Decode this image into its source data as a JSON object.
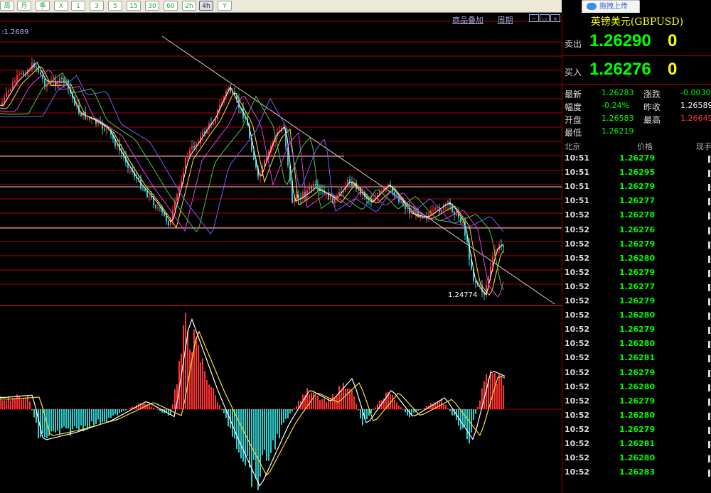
{
  "toolbar": {
    "buttons": [
      "周",
      "月",
      "季",
      "X",
      "1",
      "3",
      "5",
      "15",
      "30",
      "60",
      "2h",
      "4h",
      "Y"
    ],
    "active_index": 11
  },
  "chart_header": {
    "overlay_link": "商品叠加",
    "period_link": "周期",
    "ma_label": ":1.2689",
    "low_label": "1.24774"
  },
  "upload_button": "拖拽上传",
  "panel": {
    "title": "英镑美元(GBPUSD)",
    "sell": {
      "label": "卖出",
      "price": "1.26290",
      "suffix": "0"
    },
    "buy": {
      "label": "买入",
      "price": "1.26276",
      "suffix": "0"
    },
    "stats": [
      {
        "label": "最新",
        "value": "1.26283",
        "color": "#00ff00"
      },
      {
        "label": "涨跌",
        "value": "-0.00300",
        "color": "#00ff00"
      },
      {
        "label": "幅度",
        "value": "-0.24%",
        "color": "#00ff00"
      },
      {
        "label": "昨收",
        "value": "1.26589",
        "color": "#ffffff"
      },
      {
        "label": "开盘",
        "value": "1.26583",
        "color": "#00ff00"
      },
      {
        "label": "最高",
        "value": "1.26649",
        "color": "#ff3333"
      },
      {
        "label": "最低",
        "value": "1.26219",
        "color": "#00ff00"
      }
    ],
    "tick_headers": {
      "time": "北京",
      "price": "价格",
      "volume": "现手"
    },
    "ticks": [
      {
        "time": "10:51",
        "price": "1.26279"
      },
      {
        "time": "10:51",
        "price": "1.26295"
      },
      {
        "time": "10:51",
        "price": "1.26279"
      },
      {
        "time": "10:51",
        "price": "1.26277"
      },
      {
        "time": "10:52",
        "price": "1.26278"
      },
      {
        "time": "10:52",
        "price": "1.26276"
      },
      {
        "time": "10:52",
        "price": "1.26279"
      },
      {
        "time": "10:52",
        "price": "1.26280"
      },
      {
        "time": "10:52",
        "price": "1.26279"
      },
      {
        "time": "10:52",
        "price": "1.26277"
      },
      {
        "time": "10:52",
        "price": "1.26279"
      },
      {
        "time": "10:52",
        "price": "1.26280"
      },
      {
        "time": "10:52",
        "price": "1.26279"
      },
      {
        "time": "10:52",
        "price": "1.26280"
      },
      {
        "time": "10:52",
        "price": "1.26281"
      },
      {
        "time": "10:52",
        "price": "1.26279"
      },
      {
        "time": "10:52",
        "price": "1.26280"
      },
      {
        "time": "10:52",
        "price": "1.26279"
      },
      {
        "time": "10:52",
        "price": "1.26280"
      },
      {
        "time": "10:52",
        "price": "1.26279"
      },
      {
        "time": "10:52",
        "price": "1.26281"
      },
      {
        "time": "10:52",
        "price": "1.26280"
      },
      {
        "time": "10:52",
        "price": "1.26283"
      }
    ]
  },
  "colors": {
    "up": "#ff3333",
    "down": "#33cccc",
    "grid": "#aa0000",
    "ma_white": "#ffffff",
    "ma_yellow": "#ffdd33",
    "ma_magenta": "#dd44dd",
    "ma_green": "#44cc44",
    "ma_blue": "#6666ff",
    "trend": "#cccccc"
  },
  "chart_data": {
    "type": "candlestick",
    "key_points": {
      "price_ref": 1.2689,
      "low": 1.24774
    },
    "macd_shape": "oscillator"
  }
}
